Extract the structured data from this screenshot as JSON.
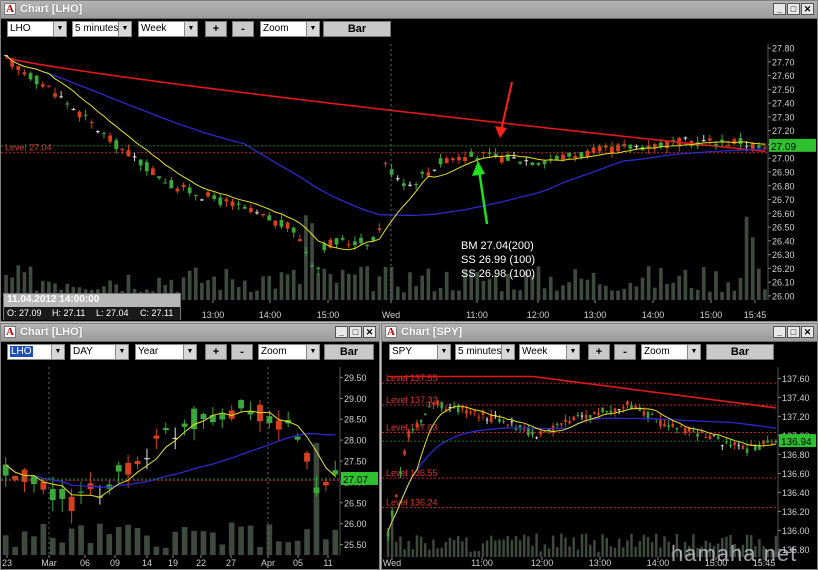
{
  "win_main": {
    "title": "Chart [LHO]",
    "symbol": "LHO",
    "interval": "5 minutes",
    "period": "Week",
    "zoom": "Zoom",
    "plus": "+",
    "minus": "-",
    "mode": "Bar",
    "level_label": "Level 27.04",
    "price_ticks": [
      "27.80",
      "27.70",
      "27.60",
      "27.50",
      "27.40",
      "27.30",
      "27.20",
      "27.10",
      "27.00",
      "26.90",
      "26.80",
      "26.70",
      "26.60",
      "26.50",
      "26.40",
      "26.30",
      "26.20",
      "26.10",
      "26.00"
    ],
    "current_price": "27.09",
    "time_ticks": [
      "13:00",
      "14:00",
      "15:00",
      "Wed",
      "11:00",
      "12:00",
      "13:00",
      "14:00",
      "15:00",
      "15:45"
    ],
    "ohlc_date": "11.04.2012 14:00:00",
    "ohlc_o": "O: 27.09",
    "ohlc_h": "H: 27.11",
    "ohlc_l": "L: 27.04",
    "ohlc_c": "C: 27.11",
    "trades": [
      "BM 27.04(200)",
      "SS 26.99 (100)",
      "SS 26.98 (100)"
    ],
    "colors": {
      "level": "#e02020",
      "sma_long": "#e01818",
      "sma_mid": "#2222cc",
      "sma_short": "#e8e020",
      "up": "#2e9a2e",
      "down": "#d8401c",
      "current": "#20c020"
    }
  },
  "win_day": {
    "title": "Chart [LHO]",
    "symbol": "LHO",
    "interval": "DAY",
    "period": "Year",
    "zoom": "Zoom",
    "plus": "+",
    "minus": "-",
    "mode": "Bar",
    "price_ticks": [
      "29.50",
      "29.00",
      "28.50",
      "28.00",
      "27.50",
      "27.00",
      "26.50",
      "26.00",
      "25.50"
    ],
    "current_price": "27.07",
    "time_ticks": [
      "23",
      "Mar",
      "06",
      "09",
      "14",
      "19",
      "22",
      "27",
      "Apr",
      "05",
      "11"
    ]
  },
  "win_spy": {
    "title": "Chart [SPY]",
    "symbol": "SPY",
    "interval": "5 minutes",
    "period": "Week",
    "zoom": "Zoom",
    "plus": "+",
    "minus": "-",
    "mode": "Bar",
    "levels": [
      "Level 137.55",
      "Level 137.32",
      "Level 137.03",
      "Level 136.55",
      "Level 136.24"
    ],
    "price_ticks": [
      "137.60",
      "137.40",
      "137.20",
      "137.00",
      "136.80",
      "136.60",
      "136.40",
      "136.20",
      "136.00",
      "135.80"
    ],
    "current_price": "136.94",
    "time_ticks": [
      "Wed",
      "11:00",
      "12:00",
      "13:00",
      "14:00",
      "15:00",
      "15:45"
    ]
  },
  "watermark": "hamaha.net"
}
